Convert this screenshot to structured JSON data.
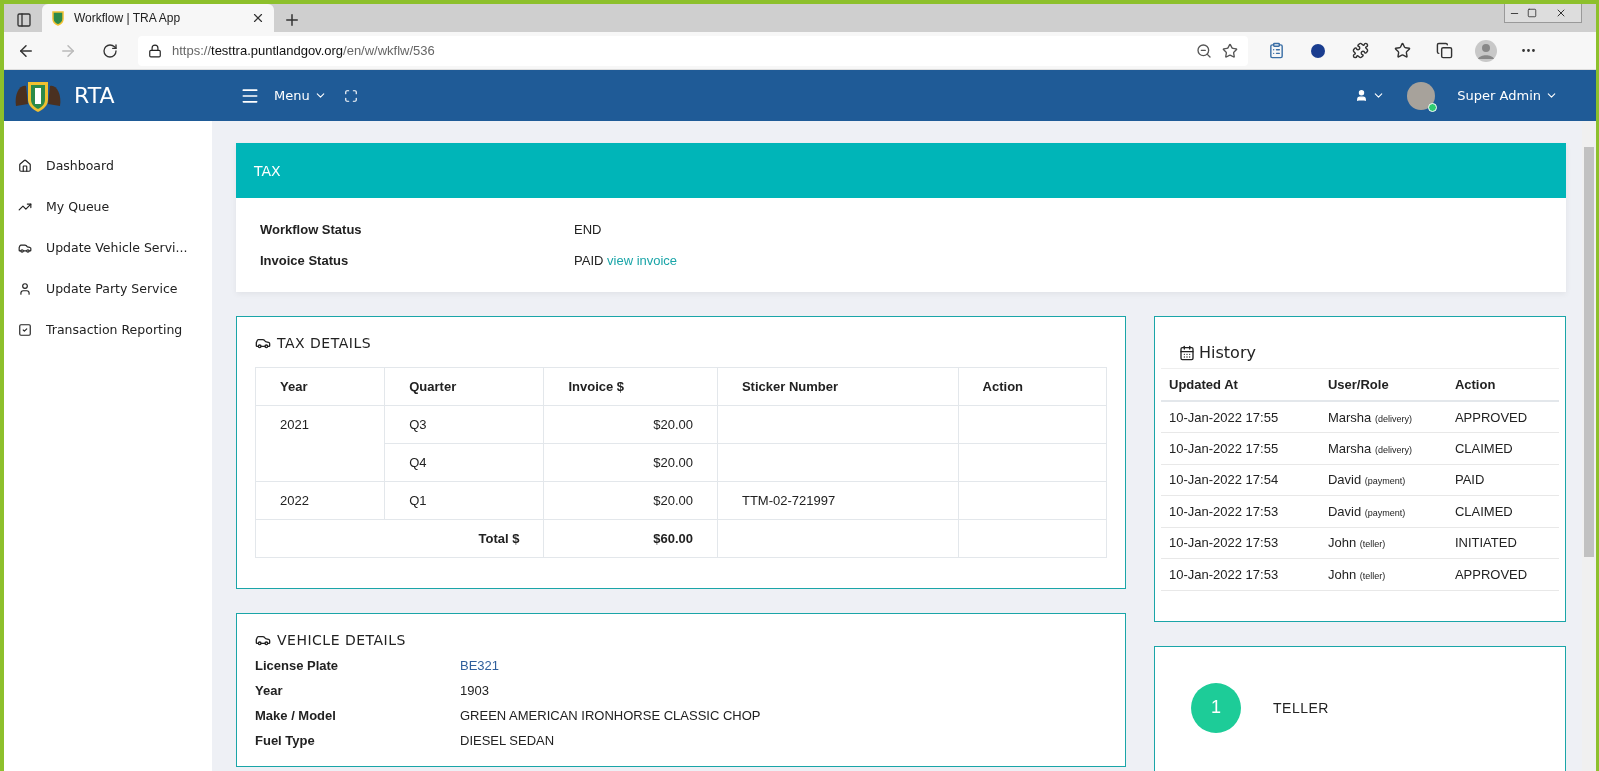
{
  "browser": {
    "tab_title": "Workflow | TRA App",
    "url_scheme": "https://",
    "url_host": "testtra.puntlandgov.org",
    "url_path": "/en/w/wkflw/536"
  },
  "header": {
    "brand": "RTA",
    "menu": "Menu",
    "user": "Super Admin",
    "user_online": true
  },
  "sidebar": {
    "items": [
      {
        "label": "Dashboard"
      },
      {
        "label": "My Queue"
      },
      {
        "label": "Update Vehicle Servi..."
      },
      {
        "label": "Update Party Service"
      },
      {
        "label": "Transaction Reporting"
      }
    ]
  },
  "tax": {
    "title": "TAX",
    "fields": [
      {
        "label": "Workflow Status",
        "value": "END"
      },
      {
        "label": "Invoice Status",
        "value": "PAID",
        "link": "view invoice"
      }
    ]
  },
  "tax_details": {
    "title": "TAX DETAILS",
    "columns": [
      "Year",
      "Quarter",
      "Invoice $",
      "Sticker Number",
      "Action"
    ],
    "years": [
      {
        "year": "2021",
        "quarters": [
          {
            "quarter": "Q3",
            "invoice": "$20.00"
          },
          {
            "quarter": "Q4",
            "invoice": "$20.00"
          }
        ]
      },
      {
        "year": "2022",
        "quarters": [
          {
            "quarter": "Q1",
            "invoice": "$20.00",
            "sticker": "TTM-02-721997"
          }
        ]
      }
    ],
    "total": {
      "label": "Total $",
      "value": "$60.00"
    }
  },
  "history": {
    "title": "History",
    "columns": [
      "Updated At",
      "User/Role",
      "Action"
    ],
    "rows": [
      {
        "updated_at": "10-Jan-2022 17:55",
        "user": "Marsha",
        "role": "(delivery)",
        "action": "APPROVED"
      },
      {
        "updated_at": "10-Jan-2022 17:55",
        "user": "Marsha",
        "role": "(delivery)",
        "action": "CLAIMED"
      },
      {
        "updated_at": "10-Jan-2022 17:54",
        "user": "David",
        "role": "(payment)",
        "action": "PAID"
      },
      {
        "updated_at": "10-Jan-2022 17:53",
        "user": "David",
        "role": "(payment)",
        "action": "CLAIMED"
      },
      {
        "updated_at": "10-Jan-2022 17:53",
        "user": "John",
        "role": "(teller)",
        "action": "INITIATED"
      },
      {
        "updated_at": "10-Jan-2022 17:53",
        "user": "John",
        "role": "(teller)",
        "action": "APPROVED"
      }
    ]
  },
  "vehicle_details": {
    "title": "VEHICLE DETAILS",
    "fields": [
      {
        "label": "License Plate",
        "value": "BE321",
        "kind": "link"
      },
      {
        "label": "Year",
        "value": "1903",
        "kind": "text"
      },
      {
        "label": "Make / Model",
        "value": "GREEN AMERICAN IRONHORSE CLASSIC CHOP",
        "kind": "text"
      },
      {
        "label": "Fuel Type",
        "value": "DIESEL SEDAN",
        "kind": "text"
      }
    ]
  },
  "steps": [
    {
      "number": "1",
      "label": "TELLER"
    }
  ]
}
